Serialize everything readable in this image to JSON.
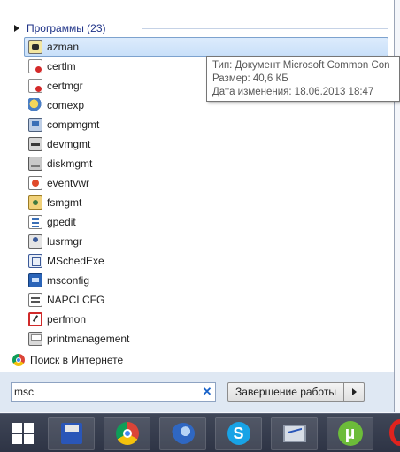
{
  "section": {
    "title": "Программы (23)"
  },
  "programs": [
    {
      "label": "azman",
      "icon": "azman-icon",
      "selected": true
    },
    {
      "label": "certlm",
      "icon": "certificate-icon"
    },
    {
      "label": "certmgr",
      "icon": "certificate-icon"
    },
    {
      "label": "comexp",
      "icon": "component-services-icon"
    },
    {
      "label": "compmgmt",
      "icon": "computer-management-icon"
    },
    {
      "label": "devmgmt",
      "icon": "device-manager-icon"
    },
    {
      "label": "diskmgmt",
      "icon": "disk-management-icon"
    },
    {
      "label": "eventvwr",
      "icon": "event-viewer-icon"
    },
    {
      "label": "fsmgmt",
      "icon": "shared-folders-icon"
    },
    {
      "label": "gpedit",
      "icon": "group-policy-icon"
    },
    {
      "label": "lusrmgr",
      "icon": "local-users-icon"
    },
    {
      "label": "MSchedExe",
      "icon": "scheduler-icon"
    },
    {
      "label": "msconfig",
      "icon": "system-config-icon"
    },
    {
      "label": "NAPCLCFG",
      "icon": "nap-config-icon"
    },
    {
      "label": "perfmon",
      "icon": "performance-monitor-icon"
    },
    {
      "label": "printmanagement",
      "icon": "print-management-icon"
    }
  ],
  "internet_search": {
    "label": "Поиск в Интернете",
    "icon": "chrome-icon"
  },
  "tooltip": {
    "type_line": "Тип: Документ Microsoft Common Con",
    "size_line": "Размер: 40,6 КБ",
    "date_line": "Дата изменения: 18.06.2013 18:47"
  },
  "search": {
    "value": "msc",
    "clear_icon": "clear-icon"
  },
  "shutdown": {
    "label": "Завершение работы",
    "arrow_icon": "chevron-right-icon"
  },
  "taskbar": {
    "items": [
      "start-button",
      "save-app-icon",
      "chrome-icon",
      "thunderbird-icon",
      "skype-icon",
      "resource-monitor-icon",
      "utorrent-icon",
      "opera-icon"
    ]
  },
  "colors": {
    "accent": "#1e3287",
    "selection": "#c9e0f9",
    "taskbar": "#2e3445"
  }
}
